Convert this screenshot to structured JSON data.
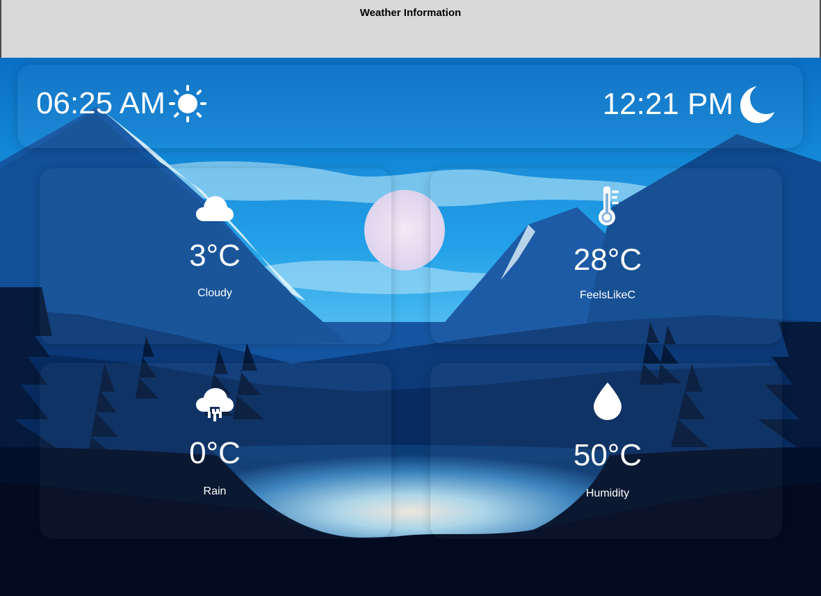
{
  "window": {
    "title": "Weather Information"
  },
  "times": {
    "sunrise": {
      "value": "06:25 AM",
      "icon": "sun-icon"
    },
    "sunset": {
      "value": "12:21 PM",
      "icon": "moon-icon"
    }
  },
  "cards": [
    {
      "icon": "cloud-icon",
      "value": "3°C",
      "label": "Cloudy"
    },
    {
      "icon": "thermometer-icon",
      "value": "28°C",
      "label": "FeelsLikeC"
    },
    {
      "icon": "rain-cloud-icon",
      "value": "0°C",
      "label": "Rain"
    },
    {
      "icon": "water-drop-icon",
      "value": "50°C",
      "label": "Humidity"
    }
  ]
}
